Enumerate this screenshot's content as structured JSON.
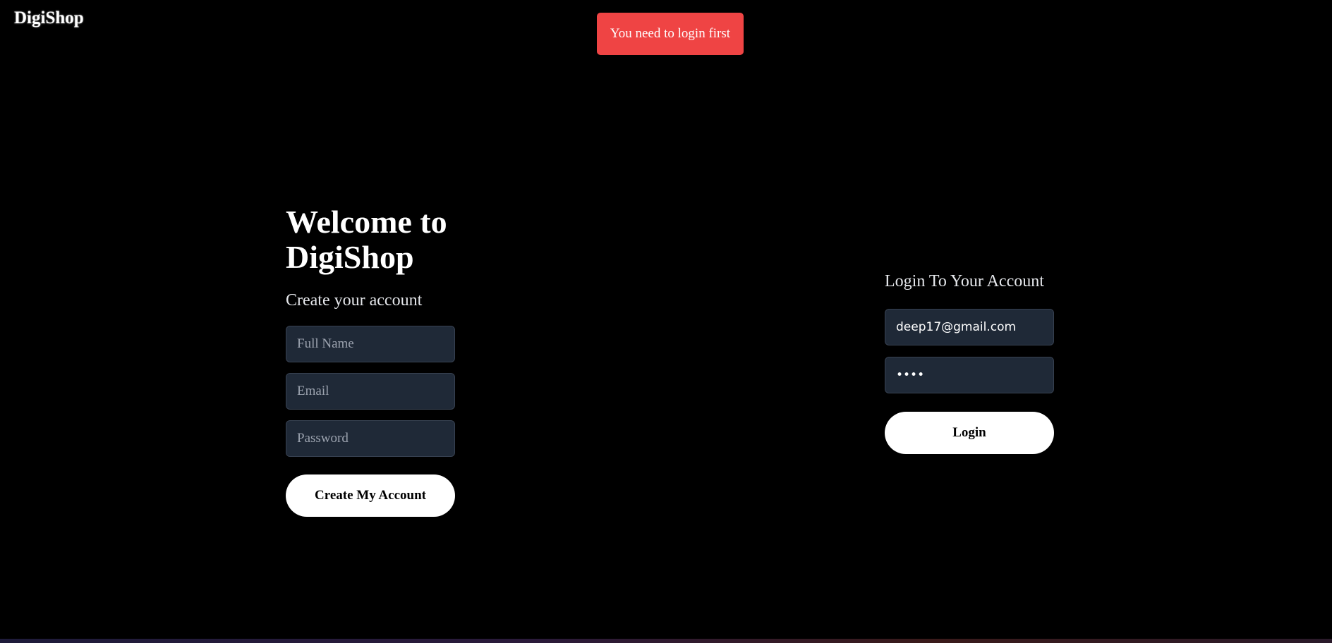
{
  "header": {
    "brand": "DigiShop"
  },
  "toast": {
    "message": "You need to login first",
    "color": "#ef4444"
  },
  "signup": {
    "title": "Welcome to DigiShop",
    "subtitle": "Create your account",
    "full_name_placeholder": "Full Name",
    "email_placeholder": "Email",
    "password_placeholder": "Password",
    "submit_label": "Create My Account"
  },
  "login": {
    "title": "Login To Your Account",
    "email_value": "deep17@gmail.com",
    "password_value": "••••",
    "submit_label": "Login"
  },
  "colors": {
    "background": "#000000",
    "input_bg": "#1f2937",
    "button_bg": "#ffffff"
  }
}
